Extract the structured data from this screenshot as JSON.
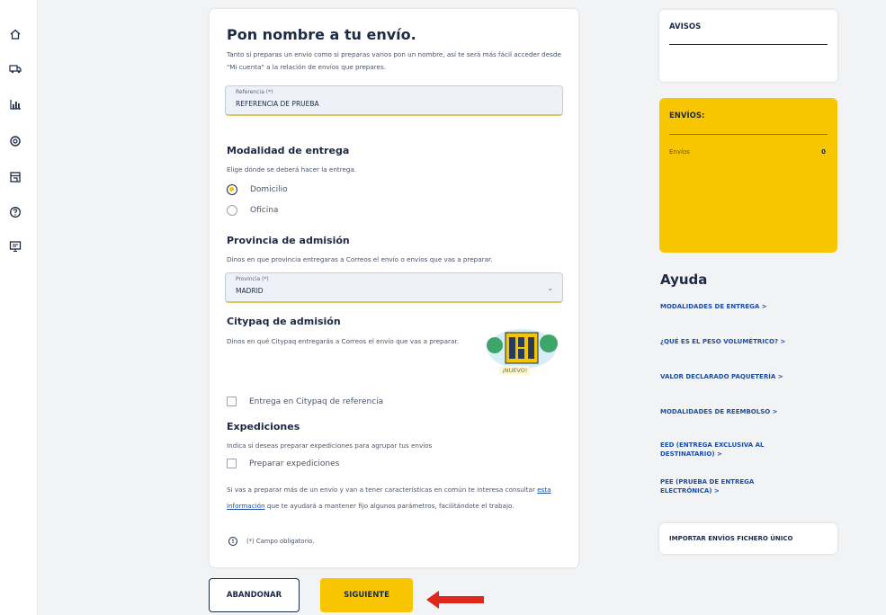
{
  "sidebar": {
    "icons": [
      "home-icon",
      "truck-icon",
      "bar-chart-icon",
      "settings-icon",
      "store-icon",
      "help-icon",
      "monitor-icon"
    ]
  },
  "form": {
    "title": "Pon nombre a tu envío.",
    "intro": "Tanto si preparas un envío como si preparas varios pon un nombre, así te será más fácil acceder desde \"Mi cuenta\" a la relación de envíos que prepares.",
    "reference": {
      "label": "Referencia (*)",
      "value": "REFERENCIA DE PRUEBA"
    },
    "delivery": {
      "title": "Modalidad de entrega",
      "description": "Elige dónde se deberá hacer la entrega.",
      "options": [
        {
          "label": "Domicilio",
          "selected": true
        },
        {
          "label": "Oficina",
          "selected": false
        }
      ]
    },
    "province": {
      "title": "Provincia de admisión",
      "description": "Dinos en que provincia entregaras a Correos el envío o envíos que vas a preparar.",
      "label": "Provincia (*)",
      "value": "MADRID"
    },
    "citypaq": {
      "title": "Citypaq de admisión",
      "description": "Dinos en qué Citypaq entregarás a Correos el envío que vas a preparar.",
      "badge": "¡NUEVO!",
      "checkbox_label": "Entrega en Citypaq de referencia"
    },
    "expediciones": {
      "title": "Expediciones",
      "description": "Indica si deseas preparar expediciones para agrupar tus envíos",
      "checkbox_label": "Preparar expediciones",
      "note_before": "Si vas a preparar más de un envío y van a tener características en común te interesa consultar ",
      "note_link": "esta información",
      "note_after": " que te ayudará a mantener fijo algunos parámetros, facilitándote el trabajo."
    },
    "required_note": "(*) Campo obligatorio."
  },
  "buttons": {
    "abandonar": "ABANDONAR",
    "siguiente": "SIGUIENTE"
  },
  "colors": {
    "accent_yellow": "#f7c600",
    "navy": "#1c2a44",
    "link_blue": "#1c4fa3",
    "arrow_red": "#e0261b"
  },
  "avisos": {
    "title": "AVISOS"
  },
  "envios": {
    "title": "ENVÍOS:",
    "row_label": "Envíos",
    "row_value": "0"
  },
  "ayuda": {
    "title": "Ayuda",
    "links": [
      "MODALIDADES DE ENTREGA  >",
      "¿QUÉ ES EL PESO VOLUMÉTRICO?  >",
      "VALOR DECLARADO PAQUETERÍA  >",
      "MODALIDADES DE REEMBOLSO  >",
      "EED (ENTREGA EXCLUSIVA AL DESTINATARIO)  >",
      "PEE (PRUEBA DE ENTREGA ELECTRÓNICA)  >"
    ]
  },
  "importar": "IMPORTAR ENVÍOS FICHERO ÚNICO"
}
